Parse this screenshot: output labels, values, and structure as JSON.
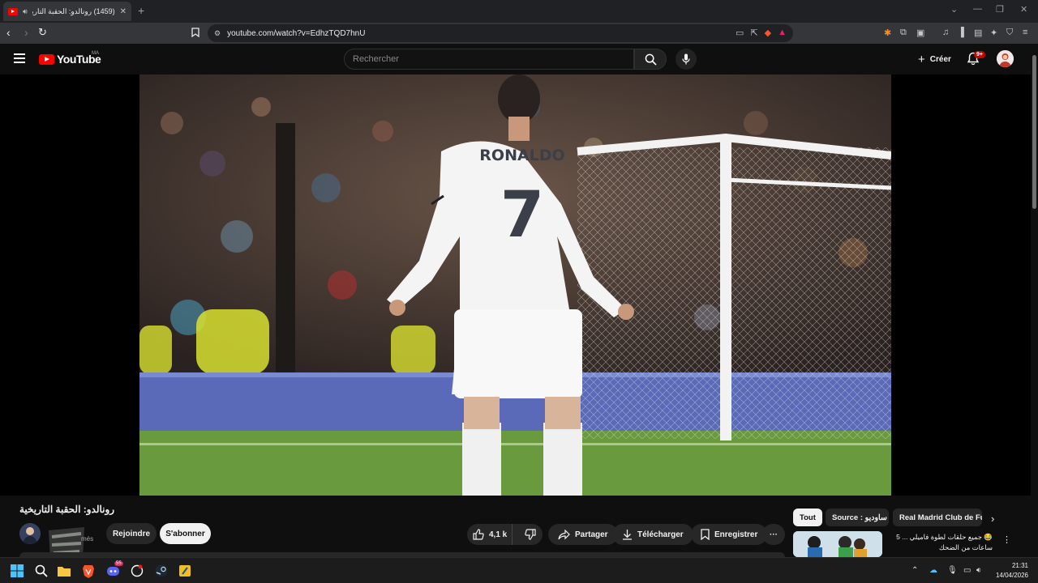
{
  "browser": {
    "tab_title": "(1459) رونالدو: الحقبة التاريخية",
    "tab_close": "✕",
    "new_tab": "+",
    "url": "youtube.com/watch?v=EdhzTQD7hnU"
  },
  "youtube": {
    "logo_text": "YouTube",
    "country_code": "MA",
    "search_placeholder": "Rechercher",
    "create_label": "Créer",
    "notifications_badge": "9+"
  },
  "video": {
    "jersey_name": "RONALDO",
    "jersey_number": "7",
    "title": "رونالدو: الحقبة التاريخية",
    "channel_subscribers_fragment": "més",
    "join_label": "Rejoindre",
    "subscribe_label": "S'abonner",
    "like_count": "4,1 k",
    "share_label": "Partager",
    "download_label": "Télécharger",
    "save_label": "Enregistrer",
    "more_label": "···"
  },
  "chips": [
    {
      "label": "Tout",
      "active": true
    },
    {
      "label": "Source : ساوديو",
      "active": false
    },
    {
      "label": "Real Madrid Club de Fútbol",
      "active": false
    }
  ],
  "recommended": {
    "title": "😂 جميع حلقات لطوة فاميلي ... 5 ساعات من الضحك"
  },
  "taskbar": {
    "discord_badge": "55",
    "time": "21:31",
    "date": "14/04/2026"
  },
  "colors": {
    "youtube_red": "#ff0000",
    "background": "#0f0f0f",
    "chip_active": "#f1f1f1"
  }
}
